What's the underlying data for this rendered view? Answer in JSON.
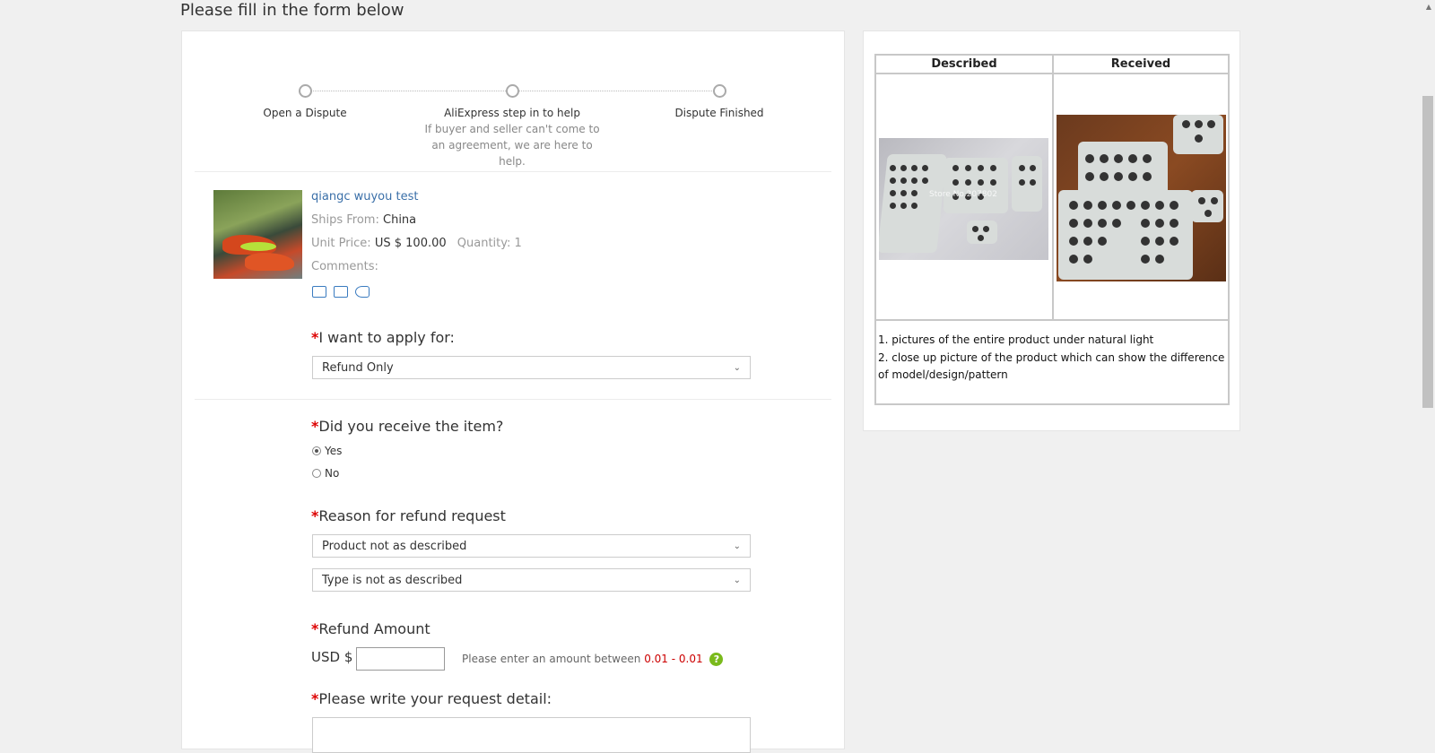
{
  "page": {
    "heading": "Please fill in the form below"
  },
  "stepper": {
    "steps": [
      {
        "label": "Open a Dispute",
        "sub": ""
      },
      {
        "label": "AliExpress step in to help",
        "sub": "If buyer and seller can't come to an agreement, we are here to help."
      },
      {
        "label": "Dispute Finished",
        "sub": ""
      }
    ]
  },
  "product": {
    "title": "qiangc wuyou test",
    "ships_from_label": "Ships From:",
    "ships_from": "China",
    "unit_price_label": "Unit Price:",
    "unit_price": "US $ 100.00",
    "quantity_label": "Quantity:",
    "quantity": "1",
    "comments_label": "Comments:"
  },
  "form": {
    "apply_for_label": "I want to apply for:",
    "apply_for_value": "Refund Only",
    "received_label": "Did you receive the item?",
    "received_options": [
      "Yes",
      "No"
    ],
    "received_selected": "Yes",
    "reason_label": "Reason for refund request",
    "reason_value": "Product not as described",
    "reason_subtype_value": "Type is not as described",
    "refund_amount_label": "Refund Amount",
    "currency_label": "USD $",
    "amount_value": "",
    "amount_hint": "Please enter an amount between",
    "amount_range": "0.01 - 0.01",
    "detail_label": "Please write your request detail:",
    "required_mark": "*"
  },
  "comparison": {
    "described_header": "Described",
    "received_header": "Received",
    "watermark": "Store No.207802",
    "notes": [
      "1. pictures of the entire product under natural light",
      "2. close up picture of the product which can show the difference of model/design/pattern"
    ]
  },
  "colors": {
    "required": "#dd0000",
    "link": "#3a6fa8",
    "help_icon": "#7aba1c",
    "range": "#cc0000"
  }
}
